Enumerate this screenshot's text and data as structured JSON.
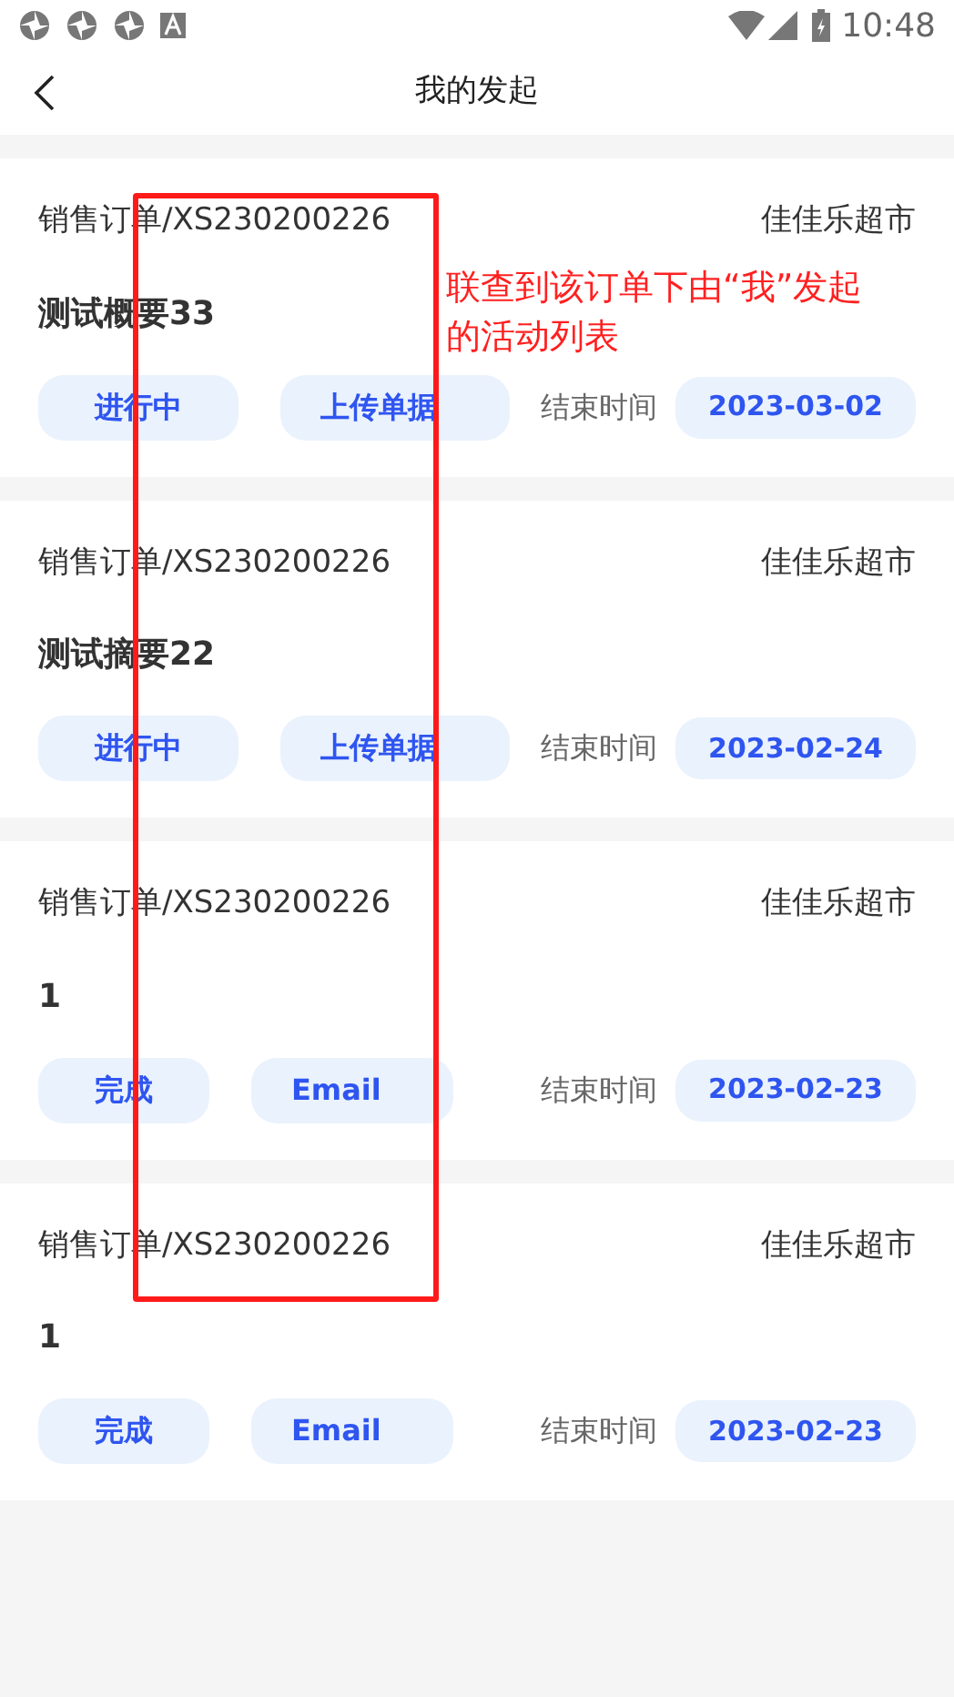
{
  "status_bar": {
    "time": "10:48"
  },
  "header": {
    "title": "我的发起"
  },
  "orders": [
    {
      "order_no": "销售订单/XS230200226",
      "customer": "佳佳乐超市",
      "title": "测试概要33",
      "status": "进行中",
      "attachment": "上传单据",
      "end_label": "结束时间",
      "end_date": "2023-03-02"
    },
    {
      "order_no": "销售订单/XS230200226",
      "customer": "佳佳乐超市",
      "title": "测试摘要22",
      "status": "进行中",
      "attachment": "上传单据",
      "end_label": "结束时间",
      "end_date": "2023-02-24"
    },
    {
      "order_no": "销售订单/XS230200226",
      "customer": "佳佳乐超市",
      "title": "1",
      "status": "完成",
      "attachment": "Email",
      "end_label": "结束时间",
      "end_date": "2023-02-23"
    },
    {
      "order_no": "销售订单/XS230200226",
      "customer": "佳佳乐超市",
      "title": "1",
      "status": "完成",
      "attachment": "Email",
      "end_label": "结束时间",
      "end_date": "2023-02-23"
    }
  ],
  "annotation": {
    "text": "联查到该订单下由“我”发起的活动列表"
  }
}
